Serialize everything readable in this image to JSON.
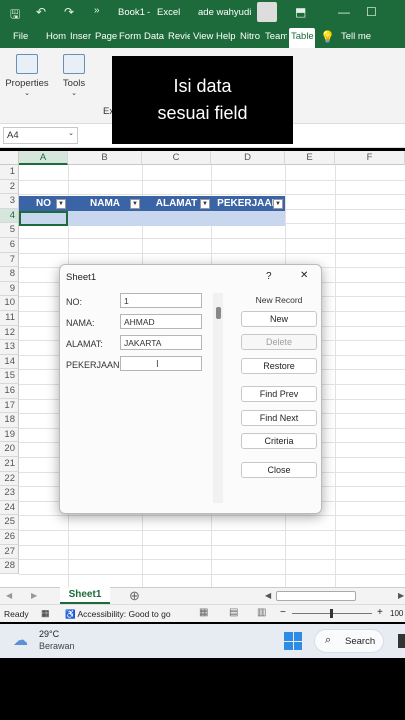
{
  "title_bar": {
    "book": "Book1",
    "app": "Excel",
    "user": "ade wahyudi"
  },
  "menu_tabs": [
    "File",
    "Hom",
    "Inser",
    "Page",
    "Form",
    "Data",
    "Revie",
    "View",
    "Help",
    "Nitro",
    "Team",
    "Table",
    "Tell me"
  ],
  "ribbon": {
    "properties": "Properties",
    "tools": "Tools",
    "ex_partial": "Ex"
  },
  "overlay_text": {
    "line1": "Isi data",
    "line2": "sesuai field"
  },
  "name_box": "A4",
  "columns": [
    "A",
    "B",
    "C",
    "D",
    "E",
    "F"
  ],
  "rows": [
    "1",
    "2",
    "3",
    "4",
    "5",
    "6",
    "7",
    "8",
    "9",
    "10",
    "11",
    "12",
    "13",
    "14",
    "15",
    "16",
    "17",
    "18",
    "19",
    "20",
    "21",
    "22",
    "23",
    "24",
    "25",
    "26",
    "27",
    "28"
  ],
  "table_headers": [
    "NO",
    "NAMA",
    "ALAMAT",
    "PEKERJAAN"
  ],
  "dialog": {
    "title": "Sheet1",
    "help": "?",
    "close": "✕",
    "status": "New Record",
    "fields": [
      {
        "label": "NO:",
        "value": "1"
      },
      {
        "label": "NAMA:",
        "value": "AHMAD"
      },
      {
        "label": "ALAMAT:",
        "value": "JAKARTA"
      },
      {
        "label": "PEKERJAAN:",
        "value": ""
      }
    ],
    "buttons": {
      "new": "New",
      "delete": "Delete",
      "restore": "Restore",
      "find_prev": "Find Prev",
      "find_next": "Find Next",
      "criteria": "Criteria",
      "close": "Close"
    }
  },
  "sheet_tab": "Sheet1",
  "status": {
    "ready": "Ready",
    "accessibility": "Accessibility: Good to go",
    "zoom": "100"
  },
  "taskbar": {
    "temp": "29°C",
    "weather": "Berawan",
    "search": "Search"
  }
}
